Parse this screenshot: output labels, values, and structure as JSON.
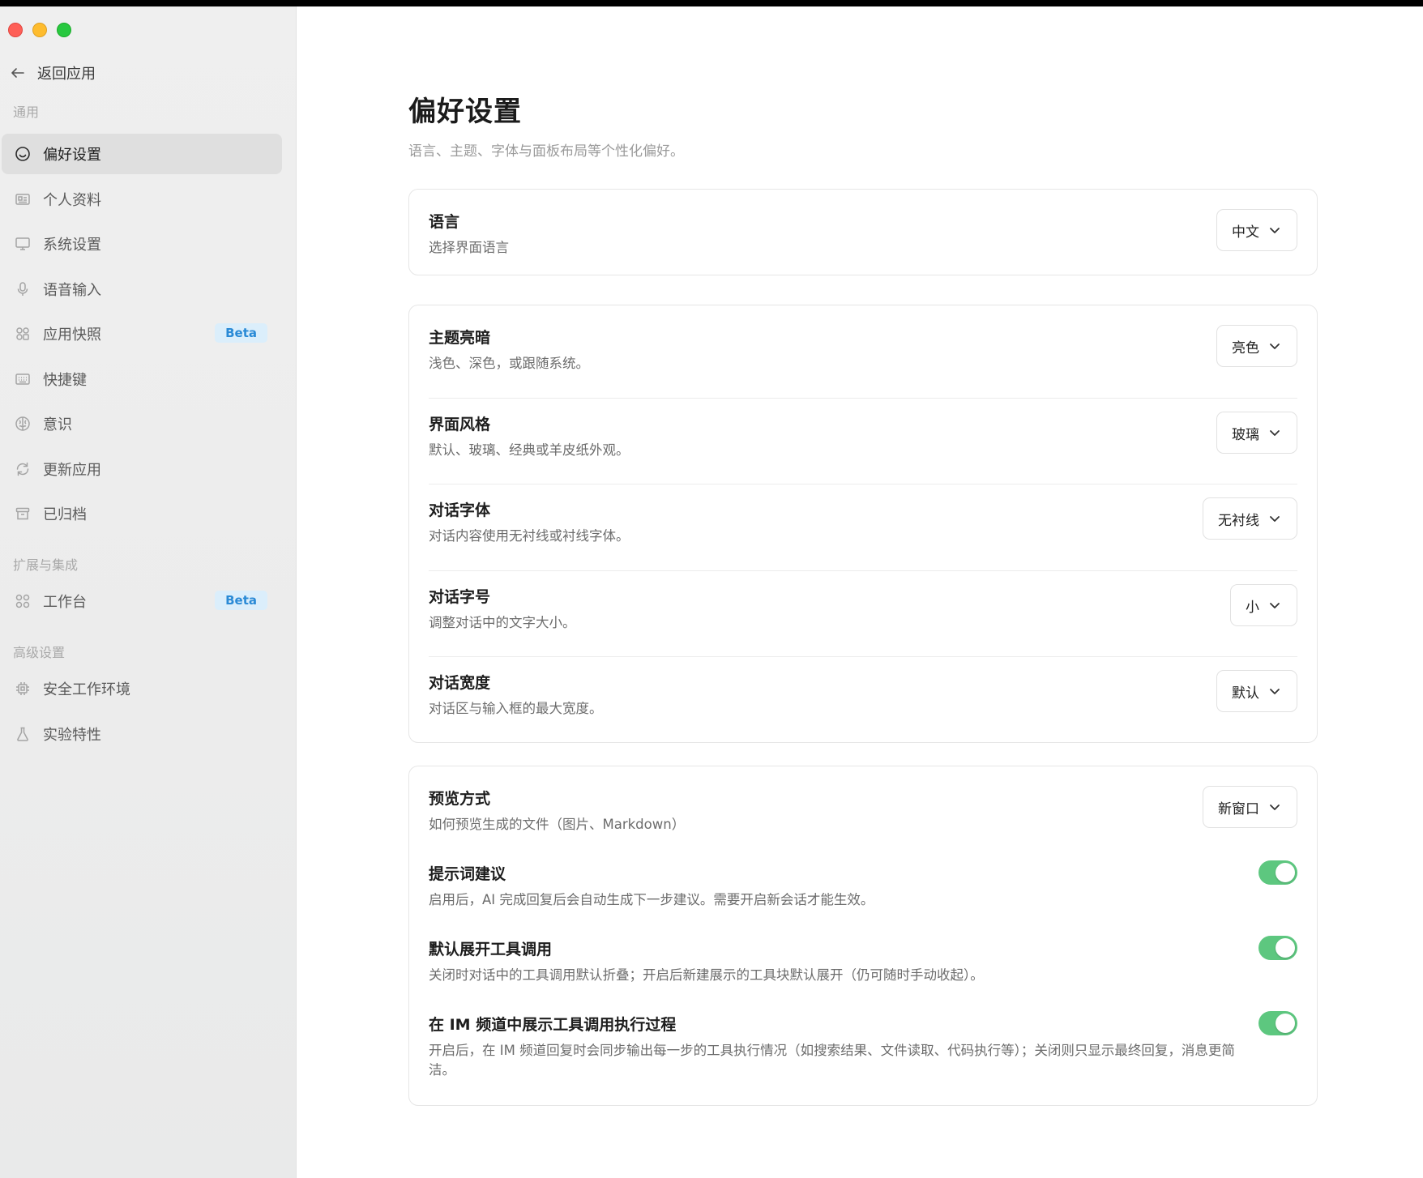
{
  "colors": {
    "accent_toggle": "#5dc77f",
    "beta_bg": "#dbeefb",
    "beta_text": "#2a8ad6",
    "sidebar_bg": "#ececec",
    "active_item_bg": "#dfdfdf"
  },
  "sidebar": {
    "back_label": "返回应用",
    "sections": {
      "general": "通用",
      "extensions": "扩展与集成",
      "advanced": "高级设置"
    },
    "items": [
      {
        "label": "偏好设置",
        "icon": "smile-icon",
        "active": true
      },
      {
        "label": "个人资料",
        "icon": "id-card-icon"
      },
      {
        "label": "系统设置",
        "icon": "monitor-icon"
      },
      {
        "label": "语音输入",
        "icon": "microphone-icon"
      },
      {
        "label": "应用快照",
        "icon": "snapshot-icon",
        "badge": "Beta"
      },
      {
        "label": "快捷键",
        "icon": "keyboard-icon"
      },
      {
        "label": "意识",
        "icon": "brain-icon"
      },
      {
        "label": "更新应用",
        "icon": "refresh-icon"
      },
      {
        "label": "已归档",
        "icon": "archive-icon"
      },
      {
        "label": "工作台",
        "icon": "grid-icon",
        "badge": "Beta"
      },
      {
        "label": "安全工作环境",
        "icon": "chip-icon"
      },
      {
        "label": "实验特性",
        "icon": "flask-icon"
      }
    ]
  },
  "main": {
    "title": "偏好设置",
    "subtitle": "语言、主题、字体与面板布局等个性化偏好。",
    "language": {
      "title": "语言",
      "desc": "选择界面语言",
      "value": "中文"
    },
    "theme": {
      "title": "主题亮暗",
      "desc": "浅色、深色，或跟随系统。",
      "value": "亮色"
    },
    "style": {
      "title": "界面风格",
      "desc": "默认、玻璃、经典或羊皮纸外观。",
      "value": "玻璃"
    },
    "font": {
      "title": "对话字体",
      "desc": "对话内容使用无衬线或衬线字体。",
      "value": "无衬线"
    },
    "font_size": {
      "title": "对话字号",
      "desc": "调整对话中的文字大小。",
      "value": "小"
    },
    "width": {
      "title": "对话宽度",
      "desc": "对话区与输入框的最大宽度。",
      "value": "默认"
    },
    "preview": {
      "title": "预览方式",
      "desc": "如何预览生成的文件（图片、Markdown）",
      "value": "新窗口"
    },
    "suggest": {
      "title": "提示词建议",
      "desc": "启用后，AI 完成回复后会自动生成下一步建议。需要开启新会话才能生效。",
      "on": true
    },
    "expand_tools": {
      "title": "默认展开工具调用",
      "desc": "关闭时对话中的工具调用默认折叠；开启后新建展示的工具块默认展开（仍可随时手动收起）。",
      "on": true
    },
    "im_tools": {
      "title": "在 IM 频道中展示工具调用执行过程",
      "desc": "开启后，在 IM 频道回复时会同步输出每一步的工具执行情况（如搜索结果、文件读取、代码执行等）；关闭则只显示最终回复，消息更简洁。",
      "on": true
    }
  }
}
